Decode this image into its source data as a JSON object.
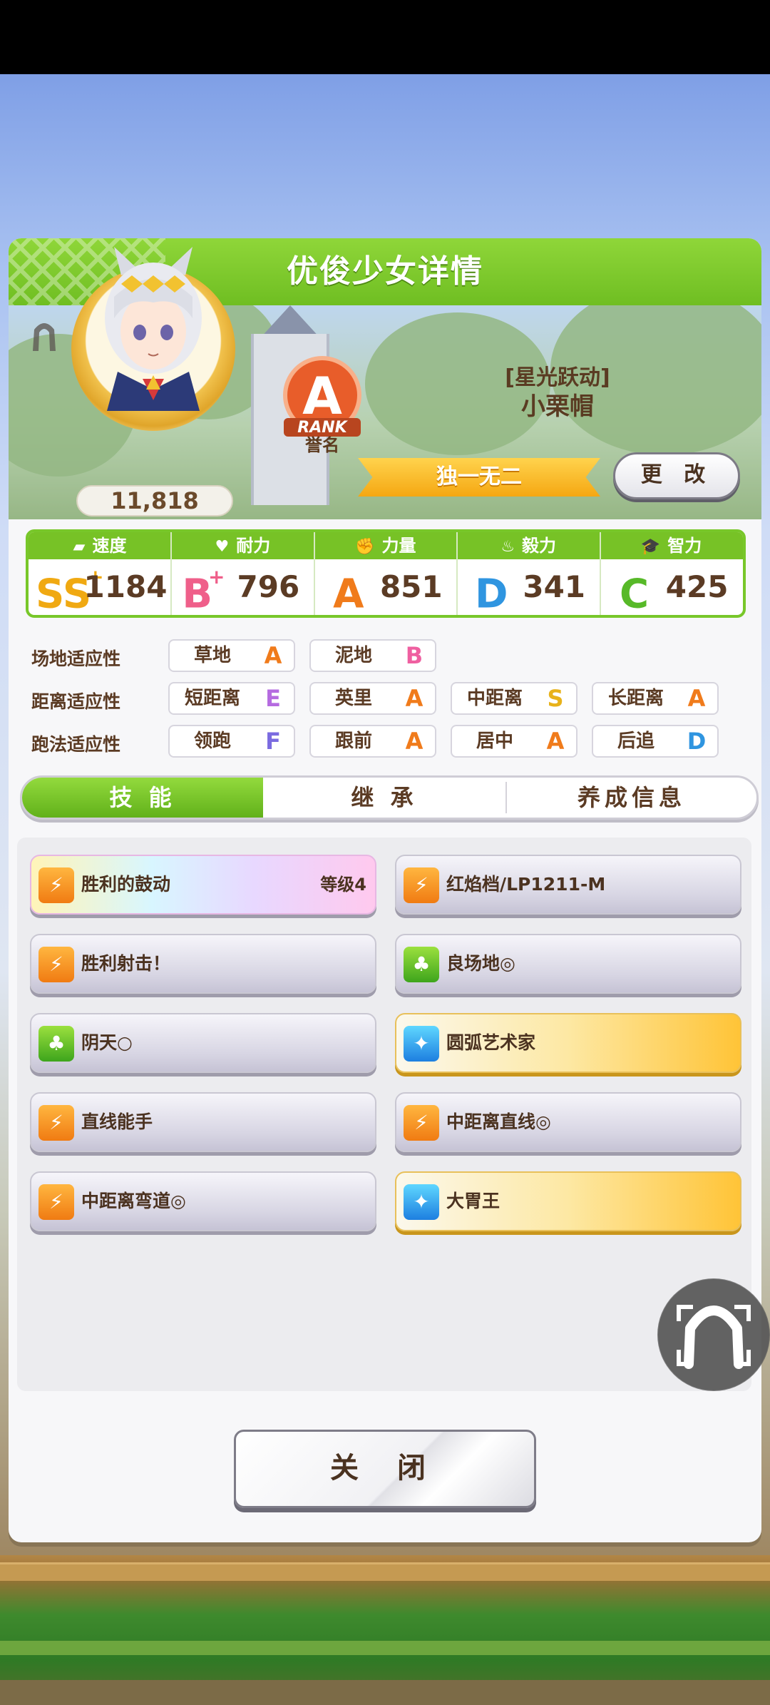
{
  "header": {
    "title": "优俊少女详情"
  },
  "profile": {
    "score": "11,818",
    "rank_letter": "A",
    "rank_word": "RANK",
    "rank_label": "誉名",
    "title": "[星光跃动]",
    "name": "小栗帽",
    "epithet": "独一无二",
    "change_label": "更 改"
  },
  "stats": [
    {
      "name": "速度",
      "icon": "shoe-icon",
      "grade": "SS",
      "plus": "+",
      "value": "1184",
      "color": "#f0a912"
    },
    {
      "name": "耐力",
      "icon": "heart-icon",
      "grade": "B",
      "plus": "+",
      "value": "796",
      "color": "#ef5f8a"
    },
    {
      "name": "力量",
      "icon": "arm-icon",
      "grade": "A",
      "plus": "",
      "value": "851",
      "color": "#f07b1b"
    },
    {
      "name": "毅力",
      "icon": "flame-icon",
      "grade": "D",
      "plus": "",
      "value": "341",
      "color": "#2f95e0"
    },
    {
      "name": "智力",
      "icon": "graduation-cap-icon",
      "grade": "C",
      "plus": "",
      "value": "425",
      "color": "#57b928"
    }
  ],
  "aptitude": {
    "track": {
      "label": "场地适应性",
      "items": [
        {
          "name": "草地",
          "grade": "A"
        },
        {
          "name": "泥地",
          "grade": "B"
        }
      ]
    },
    "distance": {
      "label": "距离适应性",
      "items": [
        {
          "name": "短距离",
          "grade": "E"
        },
        {
          "name": "英里",
          "grade": "A"
        },
        {
          "name": "中距离",
          "grade": "S"
        },
        {
          "name": "长距离",
          "grade": "A"
        }
      ]
    },
    "style": {
      "label": "跑法适应性",
      "items": [
        {
          "name": "领跑",
          "grade": "F"
        },
        {
          "name": "跟前",
          "grade": "A"
        },
        {
          "name": "居中",
          "grade": "A"
        },
        {
          "name": "后追",
          "grade": "D"
        }
      ]
    }
  },
  "grade_colors": {
    "S": "#e8b21a",
    "A": "#f07b1b",
    "B": "#ef5fa0",
    "C": "#57b928",
    "D": "#2f95e0",
    "E": "#b56be0",
    "F": "#7a6be0"
  },
  "tabs": [
    "技 能",
    "继 承",
    "养成信息"
  ],
  "skills": [
    {
      "name": "胜利的鼓动",
      "level": "等级4",
      "icon": "orange",
      "style": "rainbow"
    },
    {
      "name": "红焰档/LP1211-M",
      "level": "",
      "icon": "orange",
      "style": "silver"
    },
    {
      "name": "胜利射击！",
      "level": "",
      "icon": "orange",
      "style": "silver"
    },
    {
      "name": "良场地◎",
      "level": "",
      "icon": "green",
      "style": "silver"
    },
    {
      "name": "阴天○",
      "level": "",
      "icon": "green",
      "style": "silver"
    },
    {
      "name": "圆弧艺术家",
      "level": "",
      "icon": "blue",
      "style": "gold"
    },
    {
      "name": "直线能手",
      "level": "",
      "icon": "orange",
      "style": "silver"
    },
    {
      "name": "中距离直线◎",
      "level": "",
      "icon": "orange",
      "style": "silver"
    },
    {
      "name": "中距离弯道◎",
      "level": "",
      "icon": "orange",
      "style": "silver"
    },
    {
      "name": "大胃王",
      "level": "",
      "icon": "blue",
      "style": "gold"
    }
  ],
  "close_label": "关 闭"
}
